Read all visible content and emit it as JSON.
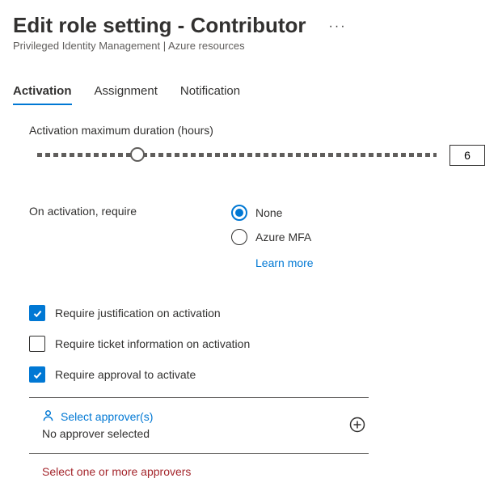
{
  "header": {
    "title": "Edit role setting - Contributor",
    "subtitle": "Privileged Identity Management | Azure resources"
  },
  "tabs": {
    "activation": "Activation",
    "assignment": "Assignment",
    "notification": "Notification"
  },
  "activation": {
    "duration_label": "Activation maximum duration (hours)",
    "duration_value": "6",
    "slider_percent": 25,
    "require_label": "On activation, require",
    "options": {
      "none": "None",
      "mfa": "Azure MFA"
    },
    "learn_more": "Learn more",
    "checks": {
      "justification": "Require justification on activation",
      "ticket": "Require ticket information on activation",
      "approval": "Require approval to activate"
    },
    "approvers": {
      "select_label": "Select approver(s)",
      "none_selected": "No approver selected",
      "error": "Select one or more approvers"
    }
  }
}
